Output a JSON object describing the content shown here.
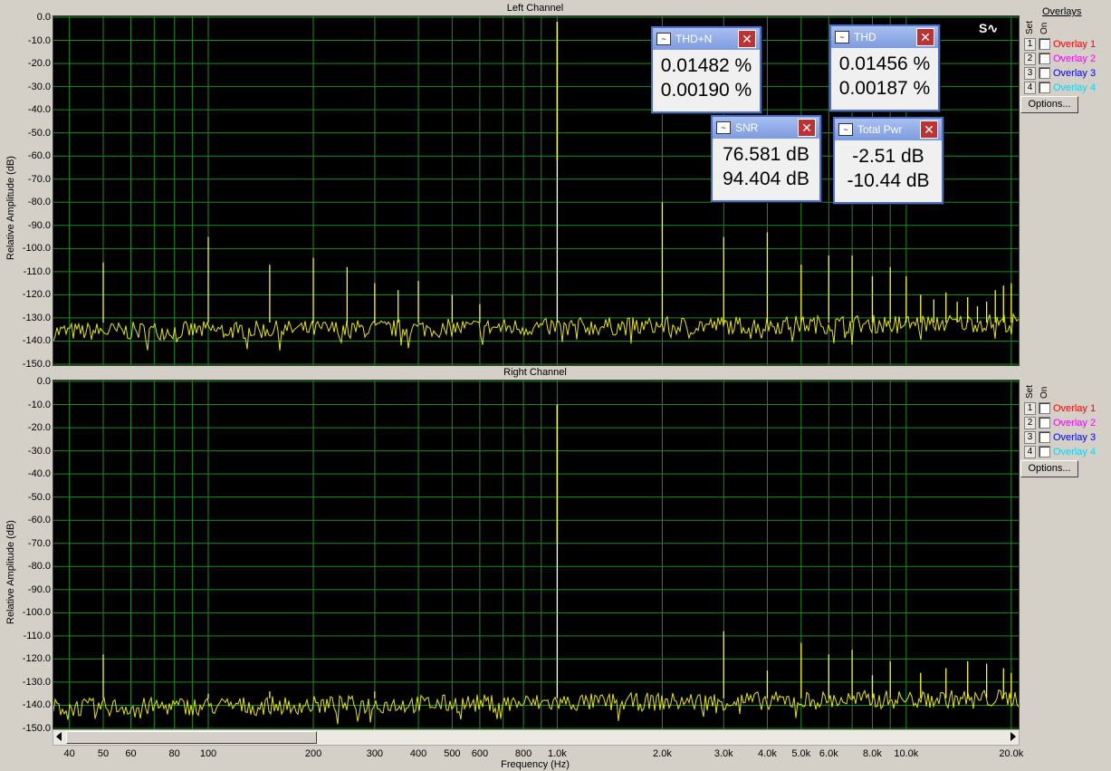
{
  "chart_data": [
    {
      "type": "line",
      "title": "Left Channel",
      "xlabel": "Frequency (Hz)",
      "ylabel": "Relative Amplitude (dB)",
      "xscale": "log",
      "xlim": [
        36,
        21000
      ],
      "ylim": [
        -150,
        0
      ],
      "grid": true,
      "yticks": [
        "0.0",
        "-10.0",
        "-20.0",
        "-30.0",
        "-40.0",
        "-50.0",
        "-60.0",
        "-70.0",
        "-80.0",
        "-90.0",
        "-100.0",
        "-110.0",
        "-120.0",
        "-130.0",
        "-140.0",
        "-150.0"
      ],
      "series_color": "#ffff00",
      "noise_floor_db": -136,
      "peaks": [
        {
          "x": 50,
          "y": -106
        },
        {
          "x": 100,
          "y": -95
        },
        {
          "x": 150,
          "y": -107
        },
        {
          "x": 200,
          "y": -104
        },
        {
          "x": 250,
          "y": -108
        },
        {
          "x": 300,
          "y": -115
        },
        {
          "x": 350,
          "y": -118
        },
        {
          "x": 400,
          "y": -114
        },
        {
          "x": 500,
          "y": -120
        },
        {
          "x": 600,
          "y": -124
        },
        {
          "x": 1000,
          "y": -2
        },
        {
          "x": 2000,
          "y": -80
        },
        {
          "x": 3000,
          "y": -95
        },
        {
          "x": 4000,
          "y": -93
        },
        {
          "x": 5000,
          "y": -107
        },
        {
          "x": 6000,
          "y": -103
        },
        {
          "x": 7000,
          "y": -103
        },
        {
          "x": 8000,
          "y": -112
        },
        {
          "x": 9000,
          "y": -108
        },
        {
          "x": 10000,
          "y": -112
        },
        {
          "x": 11000,
          "y": -120
        },
        {
          "x": 12000,
          "y": -122
        },
        {
          "x": 13000,
          "y": -119
        },
        {
          "x": 14000,
          "y": -123
        },
        {
          "x": 15000,
          "y": -121
        },
        {
          "x": 16000,
          "y": -125
        },
        {
          "x": 17000,
          "y": -123
        },
        {
          "x": 18000,
          "y": -118
        },
        {
          "x": 19000,
          "y": -116
        },
        {
          "x": 20000,
          "y": -115
        }
      ]
    },
    {
      "type": "line",
      "title": "Right Channel",
      "xlabel": "Frequency (Hz)",
      "ylabel": "Relative Amplitude (dB)",
      "xscale": "log",
      "xlim": [
        36,
        21000
      ],
      "ylim": [
        -150,
        0
      ],
      "grid": true,
      "yticks": [
        "0.0",
        "-10.0",
        "-20.0",
        "-30.0",
        "-40.0",
        "-50.0",
        "-60.0",
        "-70.0",
        "-80.0",
        "-90.0",
        "-100.0",
        "-110.0",
        "-120.0",
        "-130.0",
        "-140.0",
        "-150.0"
      ],
      "series_color": "#ffff00",
      "noise_floor_db": -141,
      "peaks": [
        {
          "x": 50,
          "y": -118
        },
        {
          "x": 100,
          "y": -135
        },
        {
          "x": 150,
          "y": -134
        },
        {
          "x": 300,
          "y": -134
        },
        {
          "x": 1000,
          "y": -10
        },
        {
          "x": 3000,
          "y": -108
        },
        {
          "x": 4000,
          "y": -125
        },
        {
          "x": 5000,
          "y": -113
        },
        {
          "x": 6000,
          "y": -118
        },
        {
          "x": 7000,
          "y": -116
        },
        {
          "x": 8000,
          "y": -127
        },
        {
          "x": 9000,
          "y": -121
        },
        {
          "x": 11000,
          "y": -126
        },
        {
          "x": 13000,
          "y": -124
        },
        {
          "x": 15000,
          "y": -121
        },
        {
          "x": 17000,
          "y": -122
        },
        {
          "x": 19000,
          "y": -124
        },
        {
          "x": 20000,
          "y": -126
        }
      ]
    }
  ],
  "xticks": [
    {
      "f": 40,
      "label": "40"
    },
    {
      "f": 50,
      "label": "50"
    },
    {
      "f": 60,
      "label": "60"
    },
    {
      "f": 80,
      "label": "80"
    },
    {
      "f": 100,
      "label": "100"
    },
    {
      "f": 200,
      "label": "200"
    },
    {
      "f": 300,
      "label": "300"
    },
    {
      "f": 400,
      "label": "400"
    },
    {
      "f": 500,
      "label": "500"
    },
    {
      "f": 600,
      "label": "600"
    },
    {
      "f": 800,
      "label": "800"
    },
    {
      "f": 1000,
      "label": "1.0k"
    },
    {
      "f": 2000,
      "label": "2.0k"
    },
    {
      "f": 3000,
      "label": "3.0k"
    },
    {
      "f": 4000,
      "label": "4.0k"
    },
    {
      "f": 5000,
      "label": "5.0k"
    },
    {
      "f": 6000,
      "label": "6.0k"
    },
    {
      "f": 8000,
      "label": "8.0k"
    },
    {
      "f": 10000,
      "label": "10.0k"
    },
    {
      "f": 20000,
      "label": "20.0k"
    }
  ],
  "overlays": {
    "heading": "Overlays",
    "set_label": "Set",
    "on_label": "On",
    "items": [
      {
        "num": "1",
        "label": "Overlay 1",
        "color": "#ff0000"
      },
      {
        "num": "2",
        "label": "Overlay 2",
        "color": "#ff00ff"
      },
      {
        "num": "3",
        "label": "Overlay 3",
        "color": "#0000ff"
      },
      {
        "num": "4",
        "label": "Overlay 4",
        "color": "#00d8ff"
      }
    ],
    "options_label": "Options..."
  },
  "meters": {
    "thdn": {
      "title": "THD+N",
      "v1": "0.01482 %",
      "v2": "0.00190 %"
    },
    "thd": {
      "title": "THD",
      "v1": "0.01456 %",
      "v2": "0.00187 %"
    },
    "snr": {
      "title": "SNR",
      "v1": "76.581 dB",
      "v2": "94.404 dB"
    },
    "pwr": {
      "title": "Total Pwr",
      "v1": "-2.51 dB",
      "v2": "-10.44 dB"
    }
  }
}
